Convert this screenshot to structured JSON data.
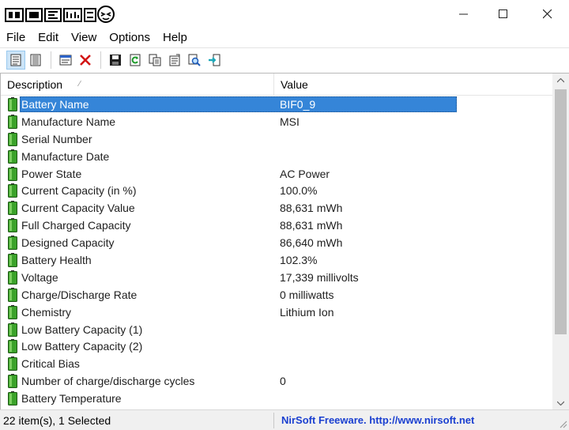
{
  "menu": [
    "File",
    "Edit",
    "View",
    "Options",
    "Help"
  ],
  "columns": {
    "description": "Description",
    "value": "Value"
  },
  "rows": [
    {
      "label": "Battery Name",
      "value": "BIF0_9",
      "selected": true
    },
    {
      "label": "Manufacture Name",
      "value": "MSI"
    },
    {
      "label": "Serial Number",
      "value": ""
    },
    {
      "label": "Manufacture Date",
      "value": ""
    },
    {
      "label": "Power State",
      "value": "AC Power"
    },
    {
      "label": "Current Capacity (in %)",
      "value": "100.0%"
    },
    {
      "label": "Current Capacity Value",
      "value": "88,631 mWh"
    },
    {
      "label": "Full Charged Capacity",
      "value": "88,631 mWh"
    },
    {
      "label": "Designed Capacity",
      "value": "86,640 mWh"
    },
    {
      "label": "Battery Health",
      "value": "102.3%"
    },
    {
      "label": "Voltage",
      "value": "17,339 millivolts"
    },
    {
      "label": "Charge/Discharge Rate",
      "value": "0 milliwatts"
    },
    {
      "label": "Chemistry",
      "value": "Lithium Ion"
    },
    {
      "label": "Low Battery Capacity (1)",
      "value": ""
    },
    {
      "label": "Low Battery Capacity (2)",
      "value": ""
    },
    {
      "label": "Critical Bias",
      "value": ""
    },
    {
      "label": "Number of charge/discharge cycles",
      "value": "0"
    },
    {
      "label": "Battery Temperature",
      "value": ""
    }
  ],
  "status": {
    "count": "22 item(s), 1 Selected",
    "link": "NirSoft Freeware.  http://www.nirsoft.net"
  },
  "icons": {
    "row": "battery-icon",
    "toolbar": [
      "html-report-view-icon",
      "detail-view-icon",
      "properties-window-icon",
      "delete-icon",
      "save-icon",
      "refresh-icon",
      "copy-icon",
      "properties-icon",
      "find-icon",
      "exit-icon"
    ]
  },
  "colors": {
    "selection": "#3585d8",
    "link": "#1a3fd0",
    "battery": "#3ba22a"
  }
}
